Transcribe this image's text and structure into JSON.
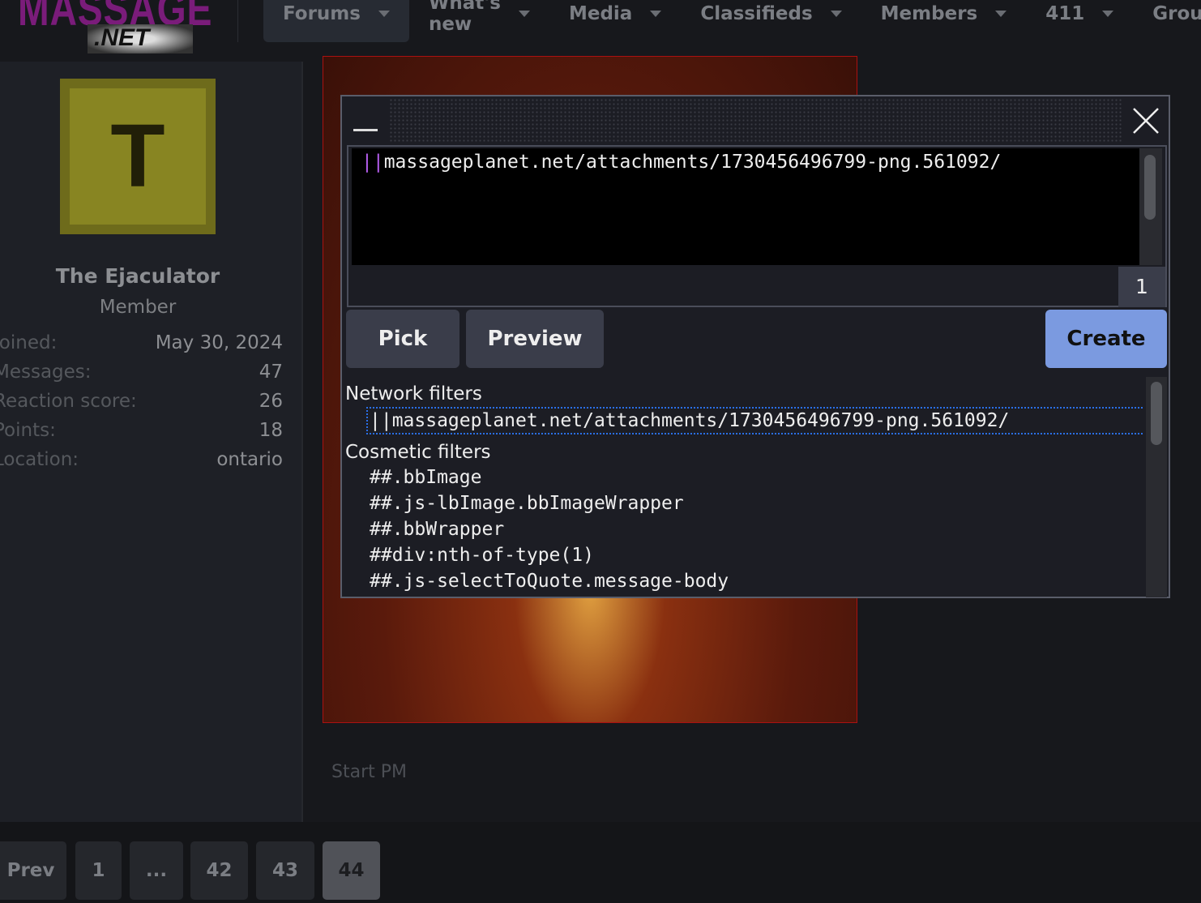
{
  "logo": {
    "text_top": "MASSAGE",
    "text_bottom": ".NET"
  },
  "nav": [
    {
      "label": "Forums",
      "active": true
    },
    {
      "label": "What's new"
    },
    {
      "label": "Media"
    },
    {
      "label": "Classifieds"
    },
    {
      "label": "Members"
    },
    {
      "label": "411"
    },
    {
      "label": "Groups"
    }
  ],
  "profile": {
    "avatar_letter": "T",
    "avatar_color": "#888522",
    "name": "The Ejaculator",
    "role": "Member",
    "stats": [
      {
        "k": "Joined:",
        "v": "May 30, 2024"
      },
      {
        "k": "Messages:",
        "v": "47"
      },
      {
        "k": "Reaction score:",
        "v": "26"
      },
      {
        "k": "Points:",
        "v": "18"
      },
      {
        "k": "Location:",
        "v": "ontario"
      }
    ]
  },
  "post": {
    "start_pm": "Start PM"
  },
  "pagination": {
    "prev": "Prev",
    "pages": [
      "1",
      "...",
      "42",
      "43",
      "44"
    ],
    "current": "44"
  },
  "dialog": {
    "editor_prefix": "||",
    "editor_value": "massageplanet.net/attachments/1730456496799-png.561092/",
    "counter": "1",
    "buttons": {
      "pick": "Pick",
      "preview": "Preview",
      "create": "Create"
    },
    "accent": "#7b9ae0",
    "network_header": "Network filters",
    "network": [
      "||massageplanet.net/attachments/1730456496799-png.561092/"
    ],
    "cosmetic_header": "Cosmetic filters",
    "cosmetic": [
      "##.bbImage",
      "##.js-lbImage.bbImageWrapper",
      "##.bbWrapper",
      "##div:nth-of-type(1)",
      "##.js-selectToQuote.message-body"
    ]
  }
}
